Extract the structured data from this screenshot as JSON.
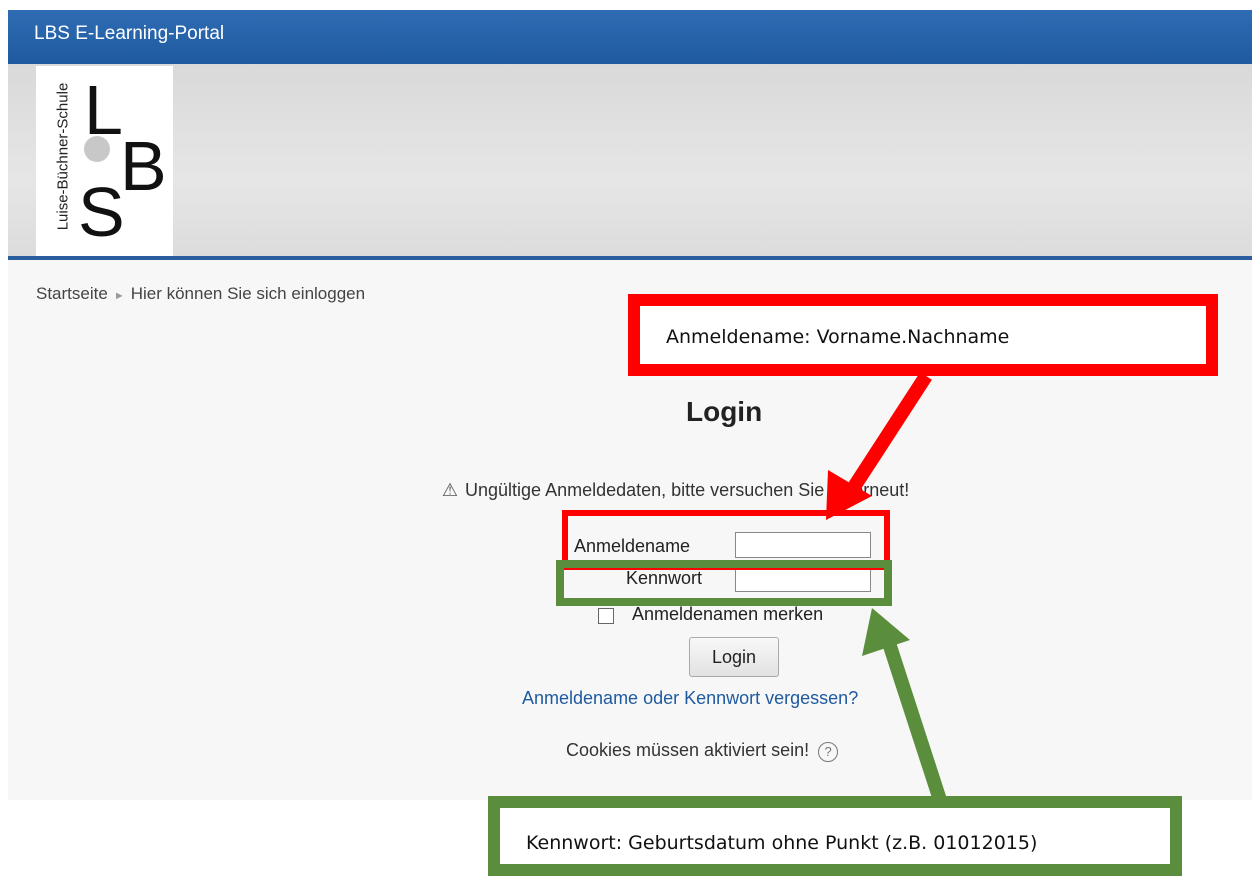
{
  "header": {
    "title": "LBS E-Learning-Portal"
  },
  "logo": {
    "vertical_text": "Luise-Büchner-Schule",
    "letter_l": "L",
    "letter_b": "B",
    "letter_s": "S"
  },
  "breadcrumb": {
    "home": "Startseite",
    "separator": "►",
    "current": "Hier können Sie sich einloggen"
  },
  "login": {
    "title": "Login",
    "error": "Ungültige Anmeldedaten, bitte versuchen Sie es erneut!",
    "username_label": "Anmeldename",
    "username_value": "",
    "password_label": "Kennwort",
    "password_value": "",
    "remember_label": "Anmeldenamen merken",
    "remember_checked": false,
    "submit_label": "Login",
    "forgot_link": "Anmeldename oder Kennwort vergessen?",
    "cookies_notice": "Cookies müssen aktiviert sein!"
  },
  "annotations": {
    "username_hint": "Anmeldename: Vorname.Nachname",
    "password_hint": "Kennwort: Geburtsdatum ohne Punkt (z.B. 01012015)"
  },
  "icons": {
    "warning": "warning-icon",
    "help": "help-icon"
  },
  "colors": {
    "header": "#1f5aa0",
    "annotation_red": "#ff0000",
    "annotation_green": "#5b8e3c",
    "link": "#1f5aa0"
  }
}
